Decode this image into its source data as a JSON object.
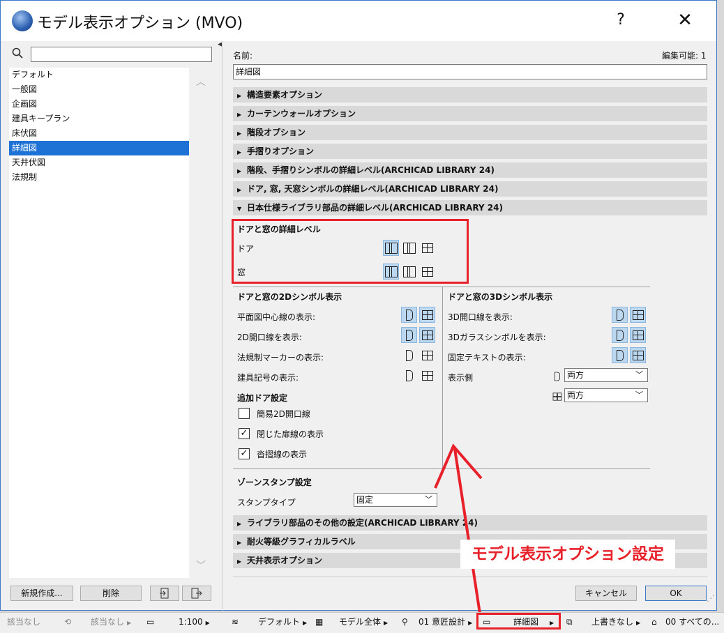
{
  "window": {
    "title": "モデル表示オプション (MVO)",
    "help_label": "?",
    "close_label": "✕"
  },
  "left": {
    "search_placeholder": "",
    "items": [
      {
        "label": "デフォルト"
      },
      {
        "label": "一般図"
      },
      {
        "label": "企画図"
      },
      {
        "label": "建具キープラン"
      },
      {
        "label": "床伏図"
      },
      {
        "label": "詳細図",
        "selected": true
      },
      {
        "label": "天井伏図"
      },
      {
        "label": "法規制"
      }
    ],
    "new_button": "新規作成...",
    "delete_button": "削除"
  },
  "right": {
    "name_label": "名前:",
    "editable_label": "編集可能: 1",
    "name_value": "詳細図",
    "sections": [
      {
        "label": "構造要素オプション"
      },
      {
        "label": "カーテンウォールオプション"
      },
      {
        "label": "階段オプション"
      },
      {
        "label": "手摺りオプション"
      },
      {
        "label": "階段、手摺りシンボルの詳細レベル(ARCHICAD LIBRARY 24)"
      },
      {
        "label": "ドア, 窓, 天窓シンボルの詳細レベル(ARCHICAD LIBRARY 24)"
      },
      {
        "label": "日本仕様ライブラリ部品の詳細レベル(ARCHICAD LIBRARY 24)",
        "expanded": true
      }
    ],
    "detail_level": {
      "heading": "ドアと窓の詳細レベル",
      "door_label": "ドア",
      "window_label": "窓"
    },
    "sym2d": {
      "heading": "ドアと窓の2Dシンボル表示",
      "rows": [
        {
          "label": "平面図中心線の表示:"
        },
        {
          "label": "2D開口線を表示:"
        },
        {
          "label": "法規制マーカーの表示:"
        },
        {
          "label": "建具記号の表示:"
        }
      ]
    },
    "sym3d": {
      "heading": "ドアと窓の3Dシンボル表示",
      "rows": [
        {
          "label": "3D開口線を表示:"
        },
        {
          "label": "3Dガラスシンボルを表示:"
        },
        {
          "label": "固定テキストの表示:"
        }
      ],
      "side_label": "表示側",
      "side_door_value": "両方",
      "side_window_value": "両方"
    },
    "extra_door": {
      "heading": "追加ドア設定",
      "options": [
        {
          "label": "簡易2D開口線",
          "checked": false
        },
        {
          "label": "閉じた扉線の表示",
          "checked": true
        },
        {
          "label": "沓摺線の表示",
          "checked": true
        }
      ]
    },
    "zone": {
      "heading": "ゾーンスタンプ設定",
      "stamp_label": "スタンプタイプ",
      "stamp_value": "固定"
    },
    "sections_bottom": [
      {
        "label": "ライブラリ部品のその他の設定(ARCHICAD LIBRARY 24)"
      },
      {
        "label": "耐火等級グラフィカルラベル"
      },
      {
        "label": "天井表示オプション"
      }
    ],
    "cancel_button": "キャンセル",
    "ok_button": "OK"
  },
  "annotation": {
    "text": "モデル表示オプション設定",
    "color": "#e8202a"
  },
  "statusbar": {
    "items": [
      {
        "label": "該当なし"
      },
      {
        "label": "該当なし"
      },
      {
        "label": "1:100"
      },
      {
        "label": "デフォルト"
      },
      {
        "label": "モデル全体"
      },
      {
        "label": "01 意匠設計"
      },
      {
        "label": "詳細図"
      },
      {
        "label": "上書きなし"
      },
      {
        "label": "00 すべての..."
      }
    ]
  }
}
